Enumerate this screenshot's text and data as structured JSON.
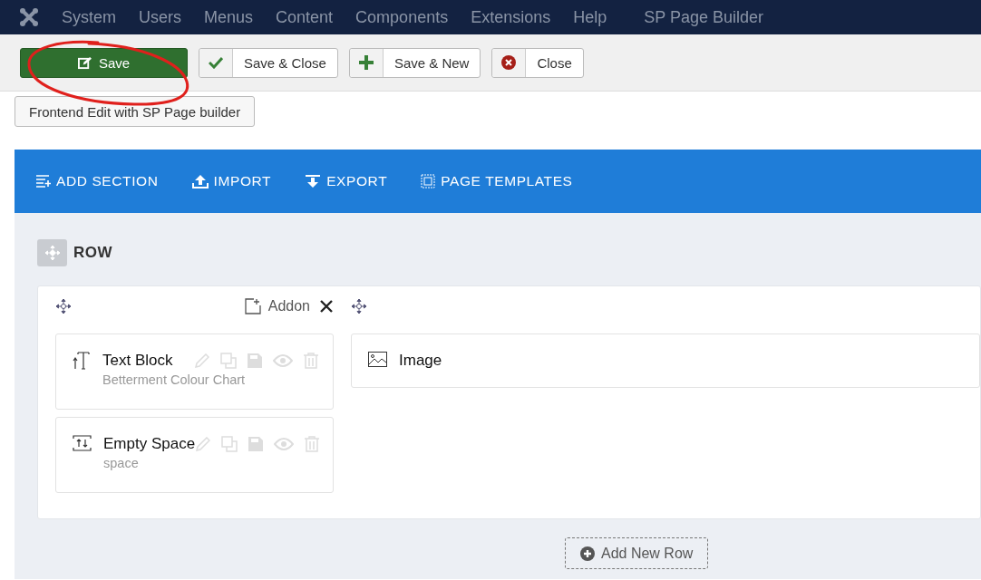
{
  "menubar": {
    "items": [
      "System",
      "Users",
      "Menus",
      "Content",
      "Components",
      "Extensions",
      "Help",
      "SP Page Builder"
    ]
  },
  "toolbar": {
    "buttons": [
      {
        "label": "Save",
        "kind": "save"
      },
      {
        "label": "Save & Close",
        "kind": "save-close"
      },
      {
        "label": "Save & New",
        "kind": "save-new"
      },
      {
        "label": "Close",
        "kind": "close"
      }
    ]
  },
  "frontend_button": "Frontend Edit with SP Page builder",
  "builder": {
    "actions": [
      {
        "label": "ADD SECTION",
        "kind": "add-section"
      },
      {
        "label": "IMPORT",
        "kind": "import"
      },
      {
        "label": "EXPORT",
        "kind": "export"
      },
      {
        "label": "PAGE TEMPLATES",
        "kind": "templates"
      }
    ],
    "row_label": "ROW",
    "columns": [
      {
        "addon_button": "Addon",
        "addons": [
          {
            "title": "Text Block",
            "subtitle": "Betterment Colour Chart",
            "kind": "text",
            "actions_visible": true
          },
          {
            "title": "Empty Space",
            "subtitle": "space",
            "kind": "space",
            "actions_visible": true
          }
        ]
      },
      {
        "addons": [
          {
            "title": "Image",
            "kind": "image",
            "actions_visible": false
          }
        ]
      }
    ],
    "add_row": "Add New Row"
  }
}
